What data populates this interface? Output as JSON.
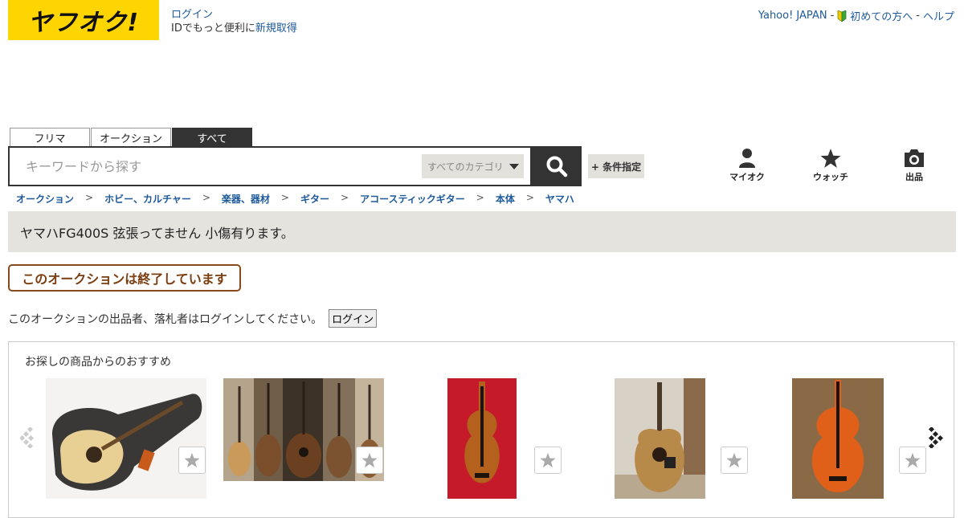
{
  "header": {
    "logo_text": "ヤフオク!",
    "login_label": "ログイン",
    "signup_prefix": "IDでもっと便利に",
    "signup_link": "新規取得",
    "top_links": {
      "yahoo": "Yahoo! JAPAN",
      "sep1": "-",
      "first_time": "初めての方へ",
      "sep2": "-",
      "help": "ヘルプ"
    }
  },
  "search": {
    "tabs": [
      "フリマ",
      "オークション",
      "すべて"
    ],
    "active_tab": "すべて",
    "placeholder": "キーワードから探す",
    "category": "すべてのカテゴリ",
    "conditions_button": "+ 条件指定"
  },
  "nav_icons": [
    {
      "label": "マイオク",
      "icon": "person-icon"
    },
    {
      "label": "ウォッチ",
      "icon": "star-icon"
    },
    {
      "label": "出品",
      "icon": "camera-icon"
    }
  ],
  "breadcrumb": [
    "オークション",
    "ホビー、カルチャー",
    "楽器、器材",
    "ギター",
    "アコースティックギター",
    "本体",
    "ヤマハ"
  ],
  "breadcrumb_sep": ">",
  "item": {
    "title": "ヤマハFG400S 弦張ってません 小傷有ります。",
    "status": "このオークションは終了しています",
    "login_notice": "このオークションの出品者、落札者はログインしてください。",
    "login_button": "ログイン"
  },
  "recommendations": {
    "heading": "お探しの商品からのおすすめ",
    "items": [
      {
        "name": "acoustic-guitar-in-case",
        "icon": "guitar-photo"
      },
      {
        "name": "guitar-collage",
        "icon": "guitar-photo"
      },
      {
        "name": "violin-red-background",
        "icon": "violin-photo"
      },
      {
        "name": "acoustic-guitar-on-stand",
        "icon": "guitar-photo"
      },
      {
        "name": "violin-orange",
        "icon": "violin-photo"
      }
    ]
  },
  "colors": {
    "logo_yellow": "#ffd500",
    "link_blue": "#1d5a9c",
    "ended_brown": "#7a3d10",
    "bar_gray": "#e5e3de"
  }
}
